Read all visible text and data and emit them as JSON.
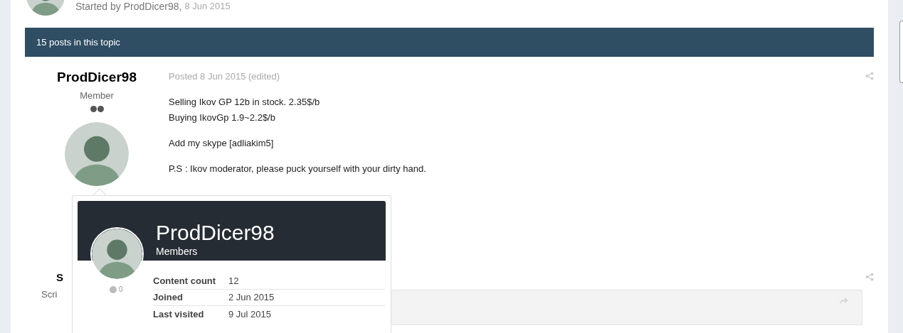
{
  "topic_header": {
    "starter": "Started by ProdDicer98,",
    "date": "8 Jun 2015"
  },
  "posts_bar": {
    "title": "15 posts in this topic"
  },
  "posts": [
    {
      "kind": "full",
      "author": "ProdDicer98",
      "rank": "Member",
      "posted": "Posted 8 Jun 2015 (edited)",
      "paragraphs": [
        [
          "Selling Ikov GP 12b in stock. 2.35$/b",
          "Buying IkovGp 1.9~2.2$/b"
        ],
        [
          "Add my skype [adliakim5]"
        ],
        [
          "P.S : Ikov moderator, please puck yourself with your dirty hand."
        ]
      ]
    },
    {
      "kind": "quoted",
      "author": "S",
      "rank": "Scri"
    }
  ],
  "hovercard": {
    "name": "ProdDicer98",
    "group": "Members",
    "reputation": "0",
    "stats": [
      {
        "label": "Content count",
        "value": "12"
      },
      {
        "label": "Joined",
        "value": "2 Jun 2015"
      },
      {
        "label": "Last visited",
        "value": "9 Jul 2015"
      }
    ]
  }
}
